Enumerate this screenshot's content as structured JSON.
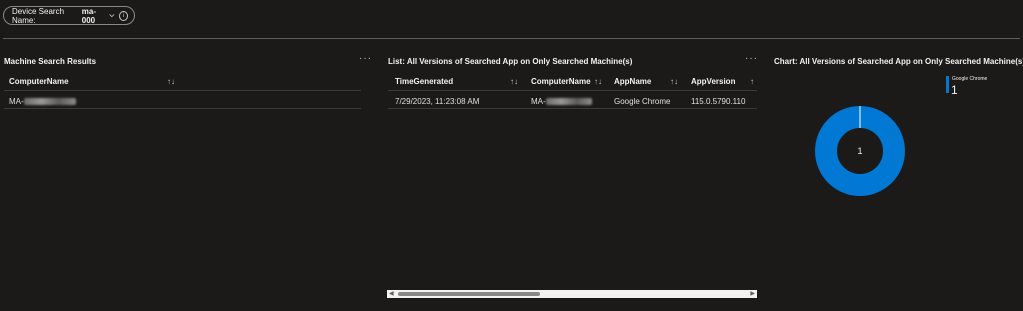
{
  "parameter": {
    "label": "Device Search Name:",
    "value": "ma-000"
  },
  "machine_panel": {
    "title": "Machine Search Results",
    "menu": "···",
    "columns": [
      "ComputerName"
    ],
    "rows": [
      {
        "computer_prefix": "MA-"
      }
    ]
  },
  "list_panel": {
    "title": "List: All Versions of Searched App on Only Searched Machine(s)",
    "menu": "···",
    "columns": [
      "TimeGenerated",
      "ComputerName",
      "AppName",
      "AppVersion"
    ],
    "rows": [
      {
        "time": "7/29/2023, 11:23:08 AM",
        "computer_prefix": "MA-",
        "app": "Google Chrome",
        "version": "115.0.5790.110"
      }
    ]
  },
  "chart_panel": {
    "title": "Chart: All Versions of Searched App on Only Searched Machine(s)"
  },
  "chart_data": {
    "type": "pie",
    "donut": true,
    "title": "Chart: All Versions of Searched App on Only Searched Machine(s)",
    "slices": [
      {
        "label": "Google Chrome",
        "value": 1,
        "color": "#0078d4"
      }
    ],
    "center_label": "1",
    "legend": {
      "placement": "top-right",
      "entries": [
        {
          "name": "Google Chrome",
          "value": "1"
        }
      ]
    }
  },
  "colors": {
    "background": "#1b1a19",
    "accent": "#0078d4",
    "text": "#f3f2f1"
  }
}
